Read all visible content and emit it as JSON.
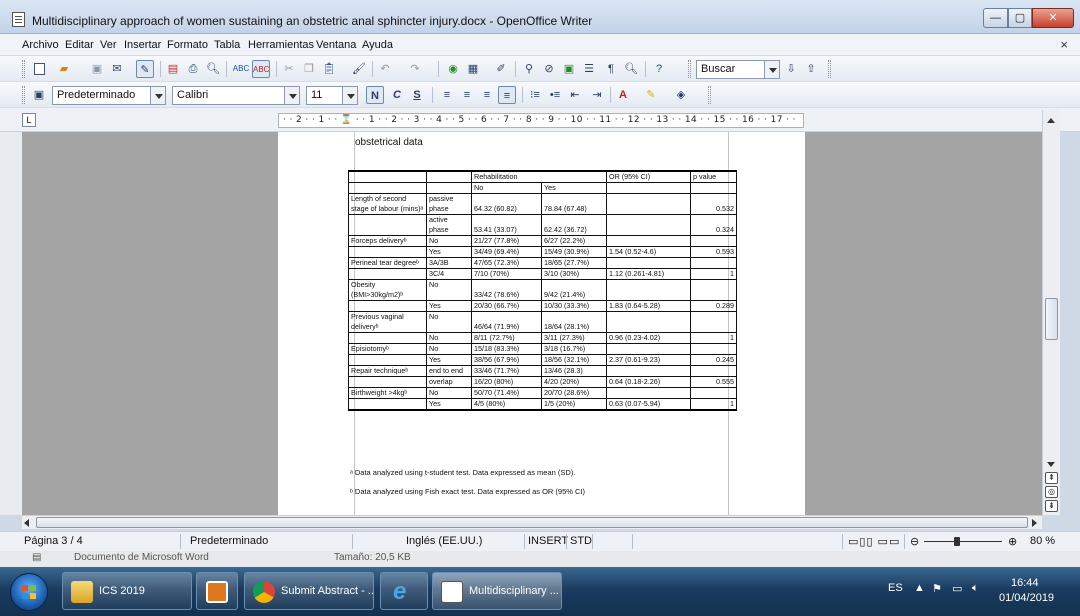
{
  "window": {
    "title": "Multidisciplinary approach of women sustaining an obstetric anal  sphincter injury.docx - OpenOffice Writer",
    "minimize": "—",
    "maximize": "▢",
    "close": "✕"
  },
  "menu": [
    "Archivo",
    "Editar",
    "Ver",
    "Insertar",
    "Formato",
    "Tabla",
    "Herramientas",
    "Ventana",
    "Ayuda"
  ],
  "doc_close": "×",
  "toolbar": {
    "search_value": "Buscar",
    "style_value": "Predeterminado",
    "font_value": "Calibri",
    "size_value": "11",
    "bold": "N",
    "italic": "C",
    "underline": "S"
  },
  "ruler": {
    "tab_marker": "L",
    "scale": "· · 2 · · 1 · · ⌛ · · 1 · · 2 · · 3 · · 4 · · 5 · · 6 · · 7 · · 8 · · 9 · · 10 · · 11 · · 12 · · 13 · · 14 · · 15 · · 16 · · 17 · ·"
  },
  "document": {
    "caption": "obstetrical data",
    "table": {
      "head1": [
        "",
        "",
        "Rehabilitation",
        "OR (95% CI)",
        "p value"
      ],
      "head2": [
        "No",
        "Yes"
      ],
      "rows": [
        {
          "label": "Length of second stage of labour (mins)ᵃ",
          "sub": "passive phase",
          "no": "64.32 (60.82)",
          "yes": "78.84 (67.48)",
          "or": "",
          "p": "0.532"
        },
        {
          "label": "",
          "sub": "active phase",
          "no": "53.41 (33.07)",
          "yes": "62.42 (36.72)",
          "or": "",
          "p": "0.324"
        },
        {
          "label": "Forceps deliveryᵇ",
          "sub": "No",
          "no": "21/27 (77.8%)",
          "yes": "6/27 (22.2%)",
          "or": "",
          "p": ""
        },
        {
          "label": "",
          "sub": "Yes",
          "no": "34/49 (69.4%)",
          "yes": "15/49 (30.9%)",
          "or": "1.54 (0.52-4.6)",
          "p": "0.593"
        },
        {
          "label": "Perineal tear degreeᵇ",
          "sub": "3A/3B",
          "no": "47/65 (72.3%)",
          "yes": "18/65 (27.7%)",
          "or": "",
          "p": ""
        },
        {
          "label": "",
          "sub": "3C/4",
          "no": "7/10 (70%)",
          "yes": "3/10 (30%)",
          "or": "1.12 (0.261-4.81)",
          "p": "1"
        },
        {
          "label": "Obesity (BMI>30kg/m2)ᵇ",
          "sub": "No",
          "no": "33/42 (78.6%)",
          "yes": "9/42 (21.4%)",
          "or": "",
          "p": ""
        },
        {
          "label": "",
          "sub": "Yes",
          "no": "20/30 (66.7%)",
          "yes": "10/30 (33.3%)",
          "or": "1.83 (0.64-5.28)",
          "p": "0.289"
        },
        {
          "label": "Previous vaginal deliveryᵇ",
          "sub": "No",
          "no": "46/64 (71.9%)",
          "yes": "18/64 (28.1%)",
          "or": "",
          "p": ""
        },
        {
          "label": "",
          "sub": "No",
          "no": "8/11 (72.7%)",
          "yes": "3/11 (27.3%)",
          "or": "0.96 (0.23-4.02)",
          "p": "1"
        },
        {
          "label": "Episiotomyᵇ",
          "sub": "No",
          "no": "15/18 (83.3%)",
          "yes": "3/18 (16.7%)",
          "or": "",
          "p": ""
        },
        {
          "label": "",
          "sub": "Yes",
          "no": "38/56 (67.9%)",
          "yes": "18/56 (32.1%)",
          "or": "2.37 (0.61-9.23)",
          "p": "0.245"
        },
        {
          "label": "Repair techniqueᵇ",
          "sub": "end to end",
          "no": "33/46 (71.7%)",
          "yes": "13/46 (28.3)",
          "or": "",
          "p": ""
        },
        {
          "label": "",
          "sub": "overlap",
          "no": "16/20 (80%)",
          "yes": "4/20 (20%)",
          "or": "0.64 (0.18-2.26)",
          "p": "0.555"
        },
        {
          "label": "Birthweight >4kgᵇ",
          "sub": "No",
          "no": "50/70 (71.4%)",
          "yes": "20/70 (28.6%)",
          "or": "",
          "p": ""
        },
        {
          "label": "",
          "sub": "Yes",
          "no": "4/5 (80%)",
          "yes": "1/5 (20%)",
          "or": "0.63 (0.07-5.94)",
          "p": "1"
        }
      ]
    },
    "notes": [
      "ᵃ Data analyzed using t-student test. Data expressed as mean (SD).",
      "ᵇ Data analyzed using Fish exact test. Data expressed as OR (95% CI)"
    ]
  },
  "statusbar": {
    "page": "Página  3 / 4",
    "style": "Predeterminado",
    "language": "Inglés (EE.UU.)",
    "insert": "INSERT",
    "std": "STD",
    "zoom": "80 %"
  },
  "background_window": {
    "type": "Documento de Microsoft Word",
    "size": "Tamaño: 20,5 KB"
  },
  "taskbar": {
    "items": [
      "ICS 2019",
      "",
      "Submit Abstract - ...",
      "",
      "Multidisciplinary ..."
    ],
    "language": "ES",
    "time": "16:44",
    "date": "01/04/2019"
  }
}
